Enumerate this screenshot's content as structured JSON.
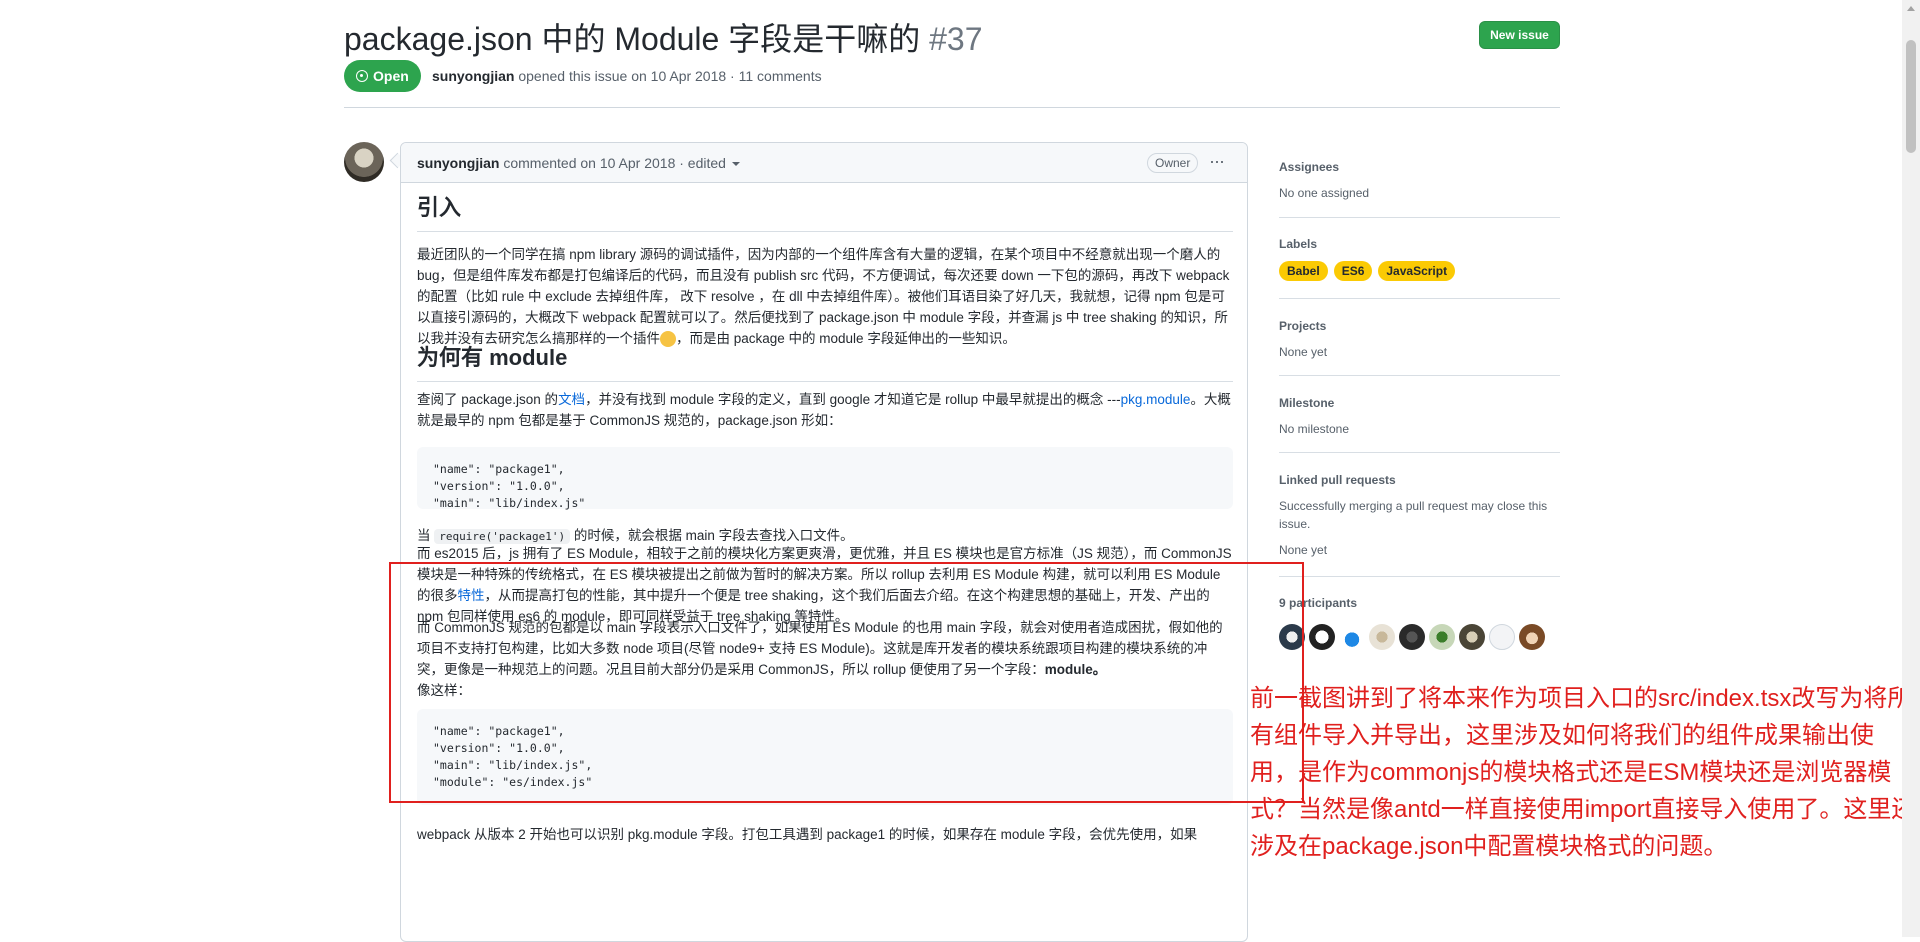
{
  "issue": {
    "title": "package.json 中的 Module 字段是干嘛的",
    "number": "#37",
    "state": "Open",
    "author": "sunyongjian",
    "meta_text": "opened this issue on 10 Apr 2018 · 11 comments",
    "new_issue_label": "New issue"
  },
  "comment": {
    "author": "sunyongjian",
    "meta_text": "commented on 10 Apr 2018 · edited",
    "owner_badge": "Owner",
    "more": "···",
    "h_intro": "引入",
    "p_intro_1": "最近团队的一个同学在搞 npm library 源码的调试插件，因为内部的一个组件库含有大量的逻辑，在某个项目中不经意就出现一个磨人的 bug，但是组件库发布都是打包编译后的代码，而且没有 publish src 代码，不方便调试，每次还要 down 一下包的源码，再改下 webpack 的配置（比如 rule 中 exclude 去掉组件库， 改下 resolve ，在 dll 中去掉组件库）。被他们耳语目染了好几天，我就想，记得 npm 包是可以直接引源码的，大概改下 webpack 配置就可以了。然后便找到了 package.json 中 module 字段，并查漏 js 中 tree shaking 的知识，所以我并没有去研究怎么搞那样的一个插件",
    "p_intro_2": "，而是由 package 中的 module 字段延伸出的一些知识。",
    "h_why": "为何有 module",
    "p_why_1": "查阅了 package.json 的",
    "link_doc": "文档",
    "p_why_2": "，并没有找到 module 字段的定义，直到 google 才知道它是 rollup 中最早就提出的概念 ---",
    "link_pkg": "pkg.module",
    "p_why_3": "。大概就是最早的 npm 包都是基于 CommonJS 规范的，package.json 形如：",
    "code1": "\"name\": \"package1\",\n\"version\": \"1.0.0\",\n\"main\": \"lib/index.js\"",
    "p_req_1": "当",
    "req_code": "require('package1')",
    "p_req_2": "的时候，就会根据 main 字段去查找入口文件。",
    "p_es_1": "而 es2015 后，js 拥有了 ES Module，相较于之前的模块化方案更爽滑，更优雅，并且 ES 模块也是官方标准（JS 规范），而 CommonJS 模块是一种特殊的传统格式，在 ES 模块被提出之前做为暂时的解决方案。所以 rollup 去利用 ES Module 构建，就可以利用 ES Module 的很多",
    "link_feature": "特性",
    "p_es_2": "，从而提高打包的性能，其中提升一个便是 tree shaking，这个我们后面去介绍。在这个构建思想的基础上，开发、产出的 npm 包同样使用 es6 的 module，即可同样受益于 tree shaking 等特性。",
    "p_cjs": "而 CommonJS 规范的包都是以 main 字段表示入口文件了，如果使用 ES Module 的也用 main 字段，就会对使用者造成困扰，假如他的项目不支持打包构建，比如大多数 node 项目(尽管 node9+ 支持 ES Module)。这就是库开发者的模块系统跟项目构建的模块系统的冲突，更像是一种规范上的问题。况且目前大部分仍是采用 CommonJS，所以 rollup 便使用了另一个字段：",
    "p_cjs_bold": "module。",
    "p_like": "像这样：",
    "code2": "\"name\": \"package1\",\n\"version\": \"1.0.0\",\n\"main\": \"lib/index.js\",\n\"module\": \"es/index.js\"",
    "p_webpack": "webpack 从版本 2 开始也可以识别 pkg.module 字段。打包工具遇到 package1 的时候，如果存在 module 字段，会优先使用，如果"
  },
  "sidebar": {
    "assignees_title": "Assignees",
    "assignees_value": "No one assigned",
    "labels_title": "Labels",
    "labels": [
      "Babel",
      "ES6",
      "JavaScript"
    ],
    "labels_color": "#fbca04",
    "projects_title": "Projects",
    "projects_value": "None yet",
    "milestone_title": "Milestone",
    "milestone_value": "No milestone",
    "linked_title": "Linked pull requests",
    "linked_desc": "Successfully merging a pull request may close this issue.",
    "linked_value": "None yet",
    "participants_title": "9 participants"
  },
  "annotation": {
    "note": "前一截图讲到了将本来作为项目入口的src/index.tsx改写为将所有组件导入并导出，这里涉及如何将我们的组件成果输出使用，是作为commonjs的模块格式还是ESM模块还是浏览器模式？当然是像antd一样直接使用import直接导入使用了。这里还涉及在package.json中配置模块格式的问题。",
    "color": "#e0201e"
  },
  "colors": {
    "open_green": "#2da44e",
    "link_blue": "#0969da"
  }
}
